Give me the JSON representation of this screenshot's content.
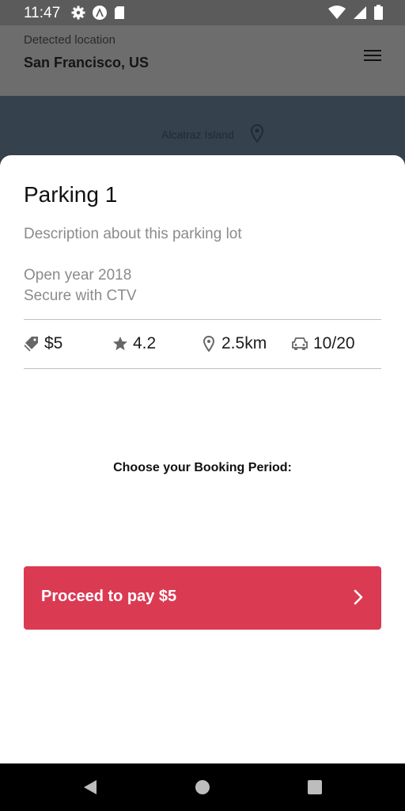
{
  "status_bar": {
    "time": "11:47",
    "left_icons": [
      "settings-icon",
      "app-a-icon",
      "sd-card-icon"
    ],
    "right_icons": [
      "wifi-icon",
      "signal-icon",
      "battery-icon"
    ]
  },
  "header": {
    "location_label": "Detected location",
    "location_value": "San Francisco, US",
    "menu_icon": "hamburger-menu-icon"
  },
  "map": {
    "place_label": "Alcatraz Island",
    "place_icon": "map-pin-icon"
  },
  "parking": {
    "title": "Parking 1",
    "description": "Description about this parking lot",
    "features": [
      "Open year 2018",
      "Secure with CTV"
    ],
    "stats": {
      "price": "$5",
      "rating": "4.2",
      "distance": "2.5km",
      "spots": "10/20"
    }
  },
  "booking": {
    "period_label": "Choose your Booking Period:"
  },
  "pay_button": {
    "label": "Proceed to pay $5"
  },
  "colors": {
    "accent": "#db3a53",
    "header_bg": "#6d6d6d",
    "map_bg": "#36414e"
  }
}
